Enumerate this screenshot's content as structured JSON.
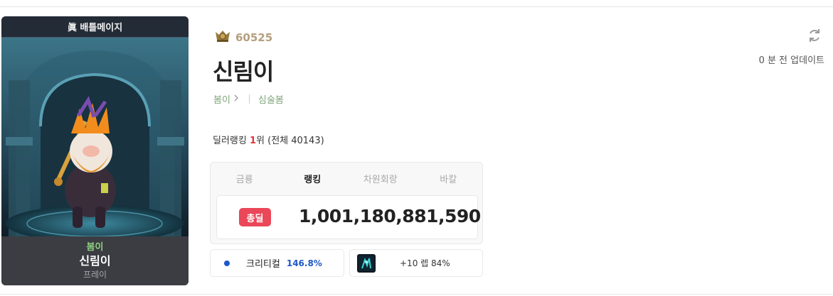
{
  "card": {
    "header": "眞 배틀메이지",
    "job": "봄이",
    "name": "신림이",
    "server": "프레이"
  },
  "profile": {
    "level": "60525",
    "name": "신림이",
    "job_link": "봄이",
    "job_detail": "심술봄",
    "rank_prefix": "딜러랭킹 ",
    "rank_value": "1",
    "rank_suffix": "위 (전체 40143)",
    "updated": "0 분 전 업데이트"
  },
  "tabs": [
    {
      "label": "금룡"
    },
    {
      "label": "랭킹"
    },
    {
      "label": "차원회랑"
    },
    {
      "label": "바칼"
    }
  ],
  "stat": {
    "badge": "총딜",
    "value": "1,001,180,881,590"
  },
  "crit": {
    "label": "크리티컬",
    "value": "146.8%"
  },
  "arcane": {
    "text": "+10 렙 84%"
  },
  "colors": {
    "badge": "#ea4758",
    "accent_blue": "#1e58c9",
    "job_green": "#7da57a",
    "level_gold": "#b59f7e"
  },
  "icons": {
    "level": "level-emblem-icon",
    "refresh": "refresh-icon",
    "chevron": "chevron-right-icon",
    "crit": "dot-icon",
    "arcane": "item-icon"
  }
}
